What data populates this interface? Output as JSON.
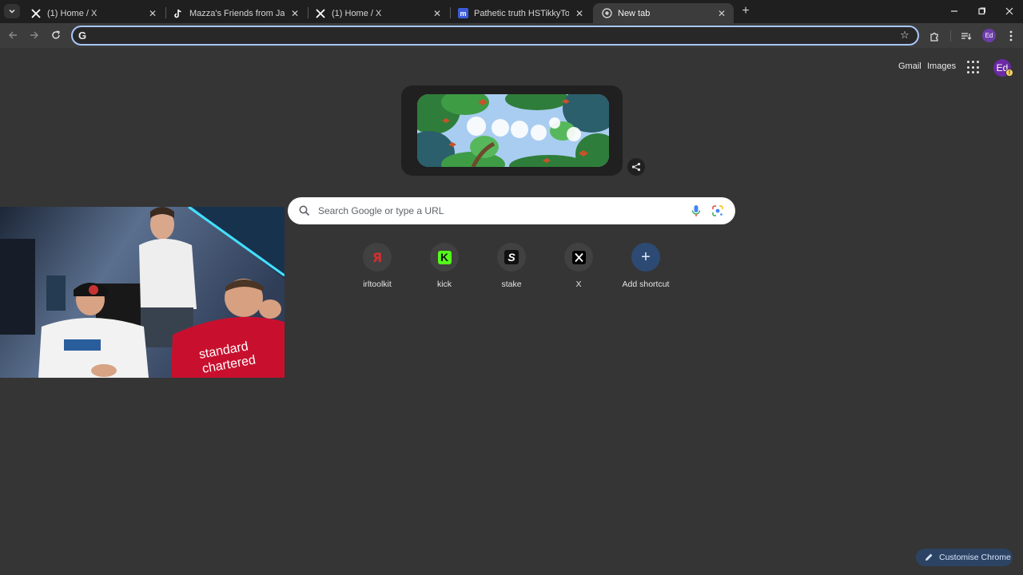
{
  "tabs": [
    {
      "title": "(1) Home / X",
      "icon": "x-logo-icon"
    },
    {
      "title": "Mazza's Friends from Jail Share",
      "icon": "tiktok-icon"
    },
    {
      "title": "(1) Home / X",
      "icon": "x-logo-icon"
    },
    {
      "title": "Pathetic truth HSTikkyTokky's h",
      "icon": "m-icon"
    },
    {
      "title": "New tab",
      "icon": "chrome-icon",
      "active": true
    }
  ],
  "toolbar": {
    "omnibox_value": "",
    "profile_initials": "Ed"
  },
  "header": {
    "gmail": "Gmail",
    "images": "Images",
    "avatar_initials": "Ed",
    "avatar_badge": "!"
  },
  "search": {
    "placeholder": "Search Google or type a URL"
  },
  "shortcuts": [
    {
      "label": "irltoolkit",
      "glyph": "Я",
      "color": "#d32f2f"
    },
    {
      "label": "kick",
      "glyph": "K",
      "color": "#53fc18"
    },
    {
      "label": "stake",
      "glyph": "S",
      "color": "#ffffff"
    },
    {
      "label": "X",
      "glyph": "X",
      "color": "#ffffff"
    },
    {
      "label": "Add shortcut",
      "glyph": "+",
      "color": "#ffffff"
    }
  ],
  "customise": {
    "label": "Customise Chrome"
  },
  "colors": {
    "page_bg": "#353535",
    "tabstrip_bg": "#1f1f1f",
    "toolbar_bg": "#3c3c3c",
    "omnibox_focus": "#a8c7fa",
    "customise_bg": "#2c4363"
  }
}
